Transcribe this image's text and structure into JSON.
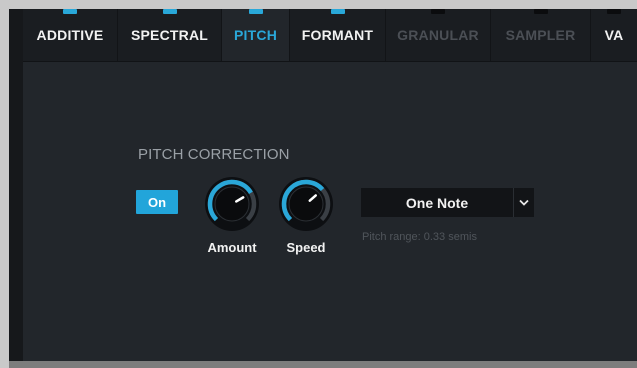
{
  "tabs": [
    {
      "label": "ADDITIVE",
      "state": "enabled",
      "indicator": true
    },
    {
      "label": "SPECTRAL",
      "state": "enabled",
      "indicator": true
    },
    {
      "label": "PITCH",
      "state": "active",
      "indicator": true
    },
    {
      "label": "FORMANT",
      "state": "enabled",
      "indicator": true
    },
    {
      "label": "GRANULAR",
      "state": "disabled",
      "indicator": false
    },
    {
      "label": "SAMPLER",
      "state": "disabled",
      "indicator": false
    },
    {
      "label": "VA",
      "state": "enabled",
      "indicator": false
    }
  ],
  "pitch_correction": {
    "title": "PITCH CORRECTION",
    "on_label": "On",
    "amount_label": "Amount",
    "speed_label": "Speed",
    "amount_value": 0.72,
    "speed_value": 0.68,
    "mode_value": "One Note",
    "range_text": "Pitch range: 0.33 semis"
  },
  "colors": {
    "accent": "#29a8d9",
    "panel": "#22262b",
    "disabled_text": "#4b4f55"
  },
  "icons": {
    "dropdown": "chevron-down-icon"
  }
}
